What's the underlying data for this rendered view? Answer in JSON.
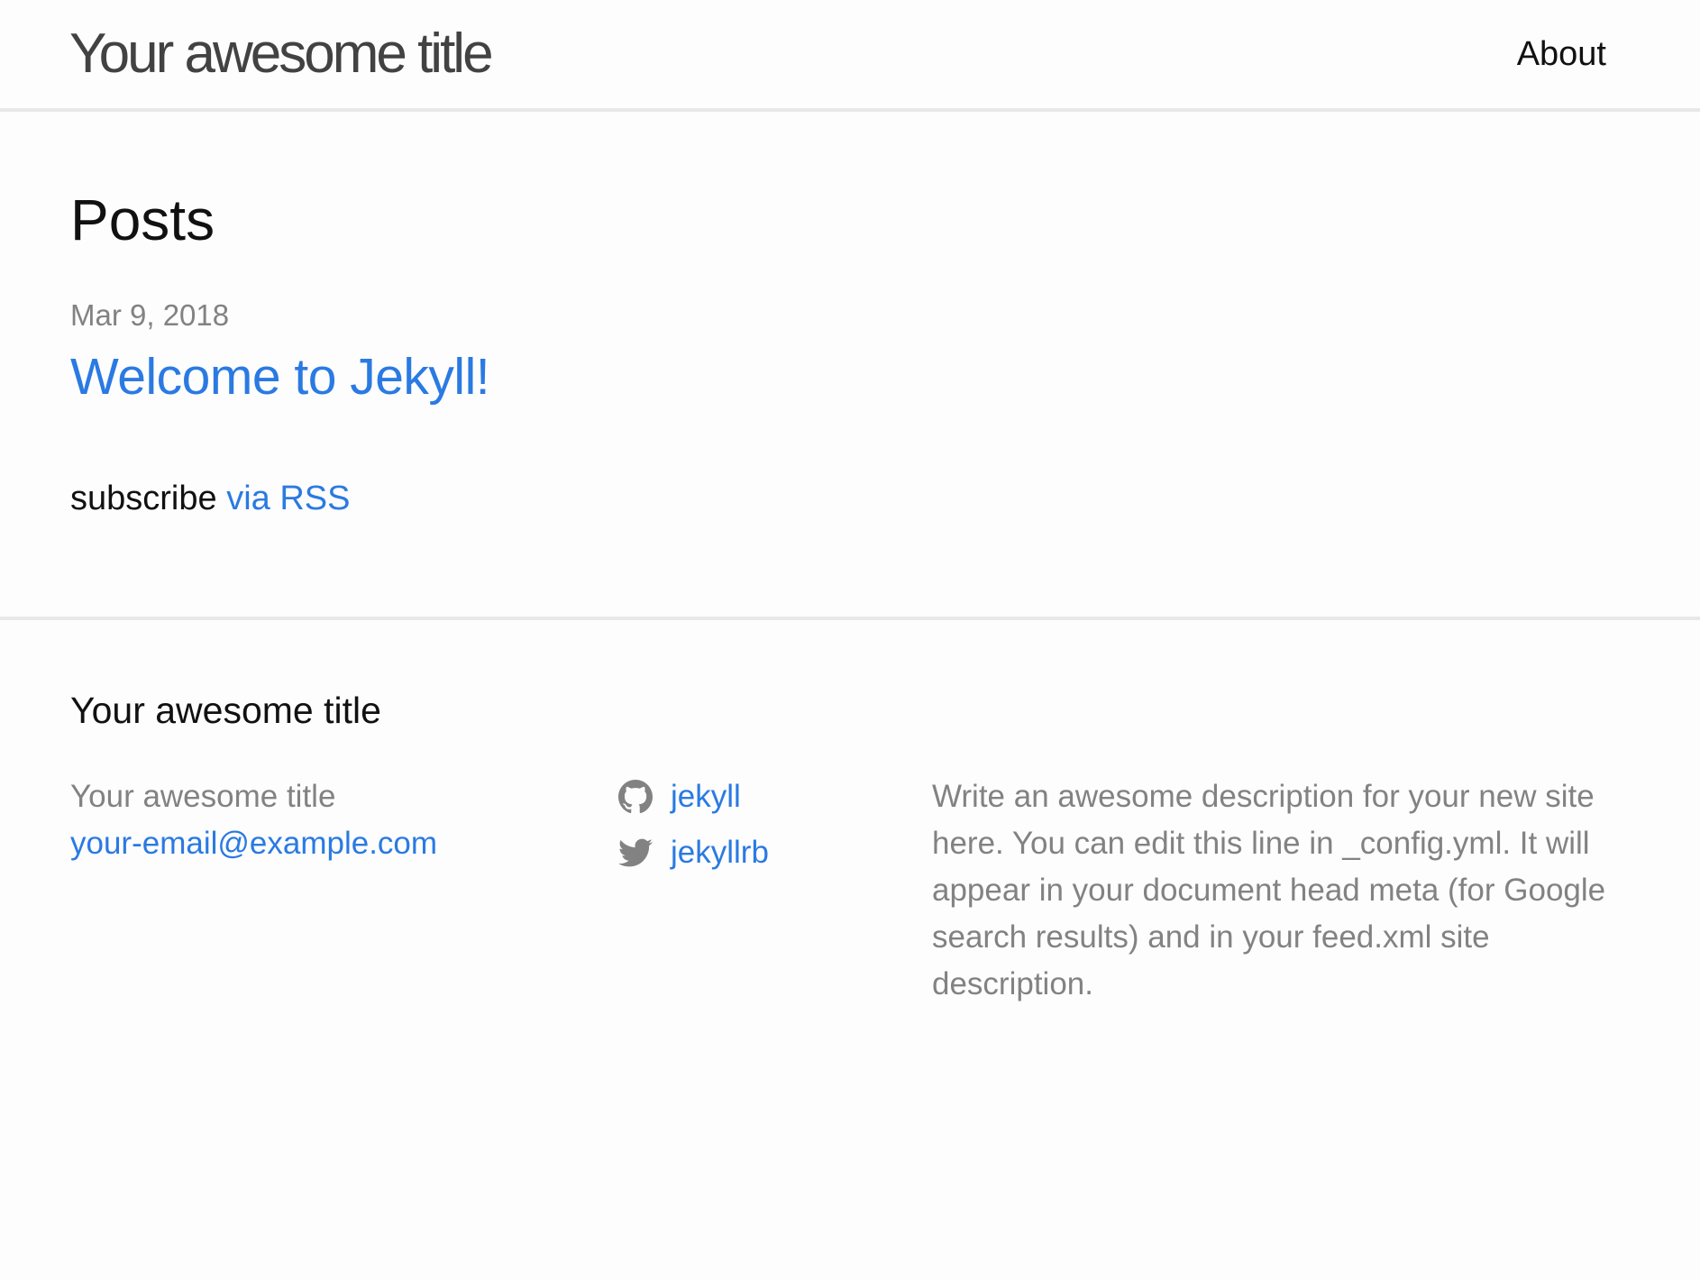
{
  "header": {
    "site_title": "Your awesome title",
    "nav": [
      {
        "label": "About"
      }
    ]
  },
  "main": {
    "heading": "Posts",
    "posts": [
      {
        "date": "Mar 9, 2018",
        "title": "Welcome to Jekyll!"
      }
    ],
    "rss": {
      "prefix": "subscribe",
      "link_label": "via RSS"
    }
  },
  "footer": {
    "heading": "Your awesome title",
    "contact": {
      "name": "Your awesome title",
      "email": "your-email@example.com"
    },
    "social": [
      {
        "icon": "github-icon",
        "label": "jekyll"
      },
      {
        "icon": "twitter-icon",
        "label": "jekyllrb"
      }
    ],
    "description": "Write an awesome description for your new site here. You can edit this line in _config.yml. It will appear in your document head meta (for Google search results) and in your feed.xml site description."
  },
  "colors": {
    "link": "#2a7ae2",
    "text": "#111111",
    "muted": "#828282",
    "border": "#e8e8e8",
    "background": "#fdfdfd"
  }
}
